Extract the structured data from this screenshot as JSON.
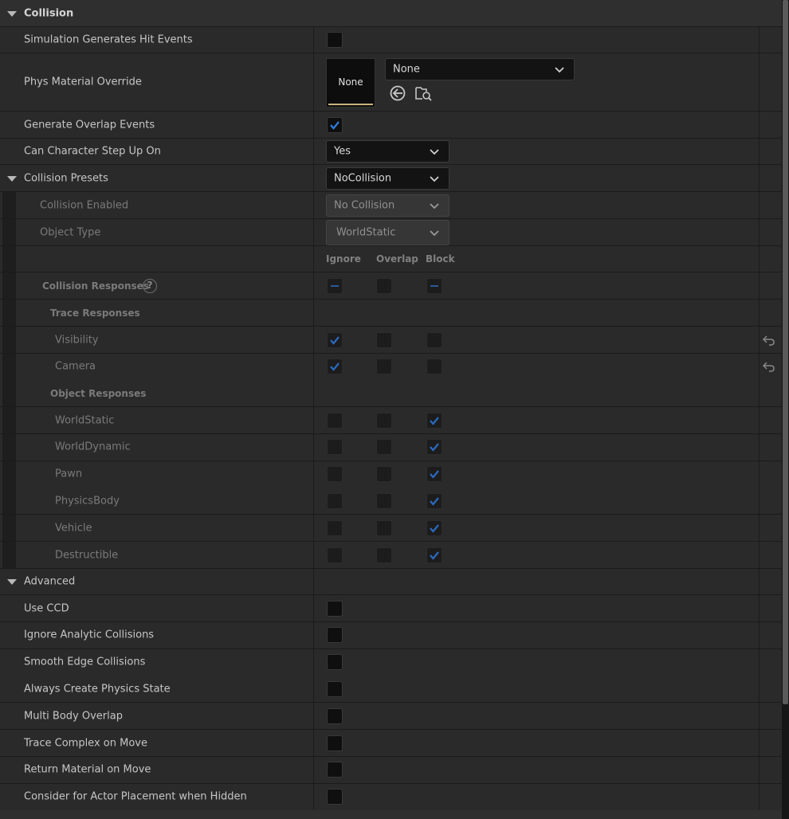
{
  "section": {
    "title": "Collision"
  },
  "rows": {
    "sim_hit": {
      "label": "Simulation Generates Hit Events",
      "checked": false
    },
    "phys_override": {
      "label": "Phys Material Override",
      "thumb": "None",
      "dropdown": "None"
    },
    "gen_overlap": {
      "label": "Generate Overlap Events",
      "checked": true
    },
    "step_up": {
      "label": "Can Character Step Up On",
      "value": "Yes"
    },
    "presets": {
      "label": "Collision Presets",
      "value": "NoCollision"
    },
    "enabled": {
      "label": "Collision Enabled",
      "value": "No Collision"
    },
    "object_type": {
      "label": "Object Type",
      "value": "WorldStatic"
    }
  },
  "columns": {
    "ignore": "Ignore",
    "overlap": "Overlap",
    "block": "Block"
  },
  "responses": {
    "title": "Collision Responses",
    "help": "?",
    "trace_title": "Trace Responses",
    "object_title": "Object Responses",
    "trace": [
      {
        "label": "Visibility",
        "ignore": true,
        "overlap": false,
        "block": false
      },
      {
        "label": "Camera",
        "ignore": true,
        "overlap": false,
        "block": false
      }
    ],
    "objects": [
      {
        "label": "WorldStatic",
        "ignore": false,
        "overlap": false,
        "block": true
      },
      {
        "label": "WorldDynamic",
        "ignore": false,
        "overlap": false,
        "block": true
      },
      {
        "label": "Pawn",
        "ignore": false,
        "overlap": false,
        "block": true
      },
      {
        "label": "PhysicsBody",
        "ignore": false,
        "overlap": false,
        "block": true
      },
      {
        "label": "Vehicle",
        "ignore": false,
        "overlap": false,
        "block": true
      },
      {
        "label": "Destructible",
        "ignore": false,
        "overlap": false,
        "block": true
      }
    ]
  },
  "advanced": {
    "title": "Advanced",
    "items": [
      {
        "label": "Use CCD",
        "checked": false
      },
      {
        "label": "Ignore Analytic Collisions",
        "checked": false
      },
      {
        "label": "Smooth Edge Collisions",
        "checked": false
      },
      {
        "label": "Always Create Physics State",
        "checked": false
      },
      {
        "label": "Multi Body Overlap",
        "checked": false
      },
      {
        "label": "Trace Complex on Move",
        "checked": false
      },
      {
        "label": "Return Material on Move",
        "checked": false
      },
      {
        "label": "Consider for Actor Placement when Hidden",
        "checked": false
      }
    ]
  },
  "colors": {
    "accent_check": "#2f7de1",
    "background": "#242424"
  }
}
